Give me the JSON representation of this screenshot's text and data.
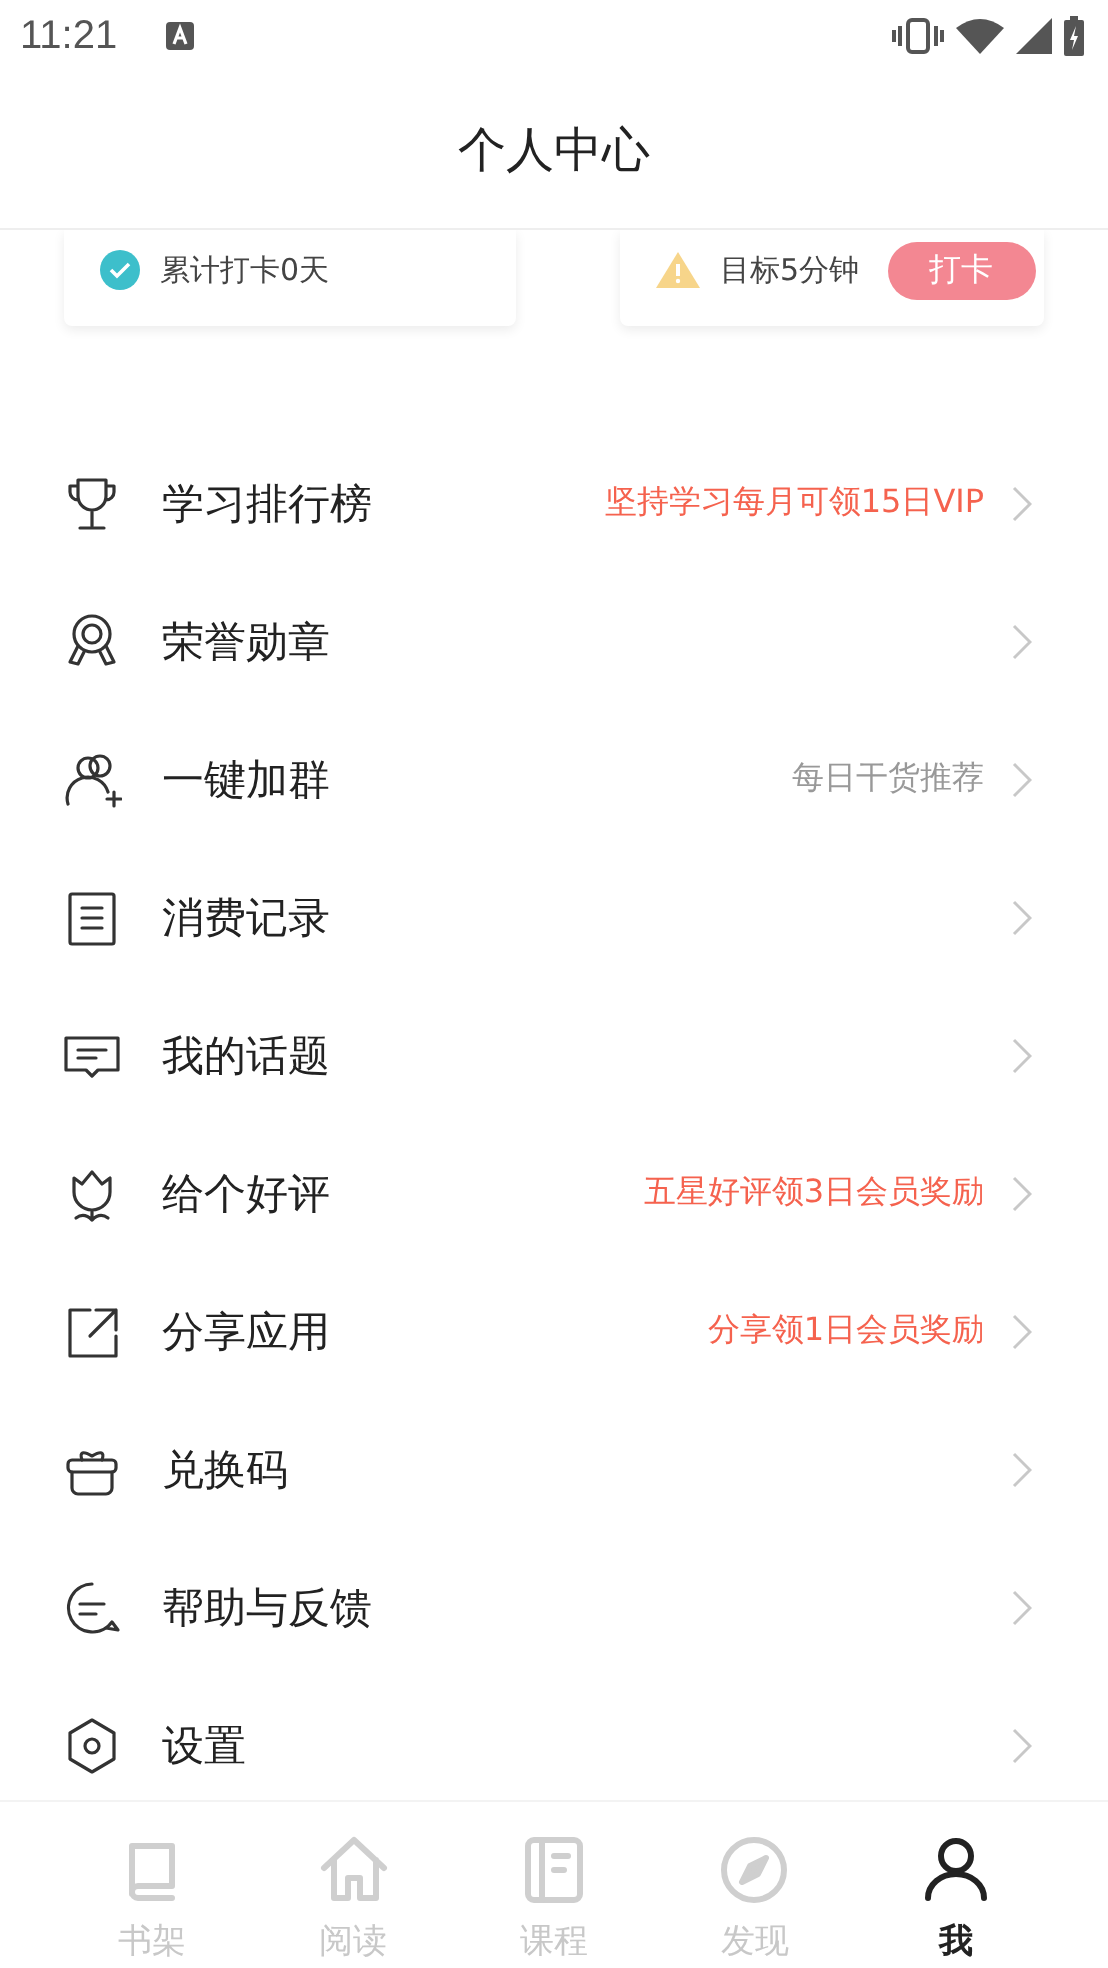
{
  "status_bar": {
    "time": "11:21"
  },
  "header": {
    "title": "个人中心"
  },
  "cards": [
    {
      "kind": "checkin",
      "text": "累计打卡0天"
    },
    {
      "kind": "goal",
      "text": "目标5分钟",
      "button": "打卡"
    }
  ],
  "menu": [
    {
      "kind": "trophy",
      "label": "学习排行榜",
      "hint": "坚持学习每月可领15日VIP",
      "hint_emphasis": true
    },
    {
      "kind": "medal",
      "label": "荣誉勋章"
    },
    {
      "kind": "group",
      "label": "一键加群",
      "hint": "每日干货推荐",
      "hint_emphasis": false
    },
    {
      "kind": "list",
      "label": "消费记录"
    },
    {
      "kind": "chat",
      "label": "我的话题"
    },
    {
      "kind": "tulip",
      "label": "给个好评",
      "hint": "五星好评领3日会员奖励",
      "hint_emphasis": true
    },
    {
      "kind": "share",
      "label": "分享应用",
      "hint": "分享领1日会员奖励",
      "hint_emphasis": true
    },
    {
      "kind": "gift",
      "label": "兑换码"
    },
    {
      "kind": "help",
      "label": "帮助与反馈"
    },
    {
      "kind": "settings",
      "label": "设置"
    }
  ],
  "tabs": [
    {
      "kind": "book",
      "label": "书架",
      "selected": false
    },
    {
      "kind": "home",
      "label": "阅读",
      "selected": false
    },
    {
      "kind": "course",
      "label": "课程",
      "selected": false
    },
    {
      "kind": "compass",
      "label": "发现",
      "selected": false
    },
    {
      "kind": "person",
      "label": "我",
      "selected": true
    }
  ]
}
